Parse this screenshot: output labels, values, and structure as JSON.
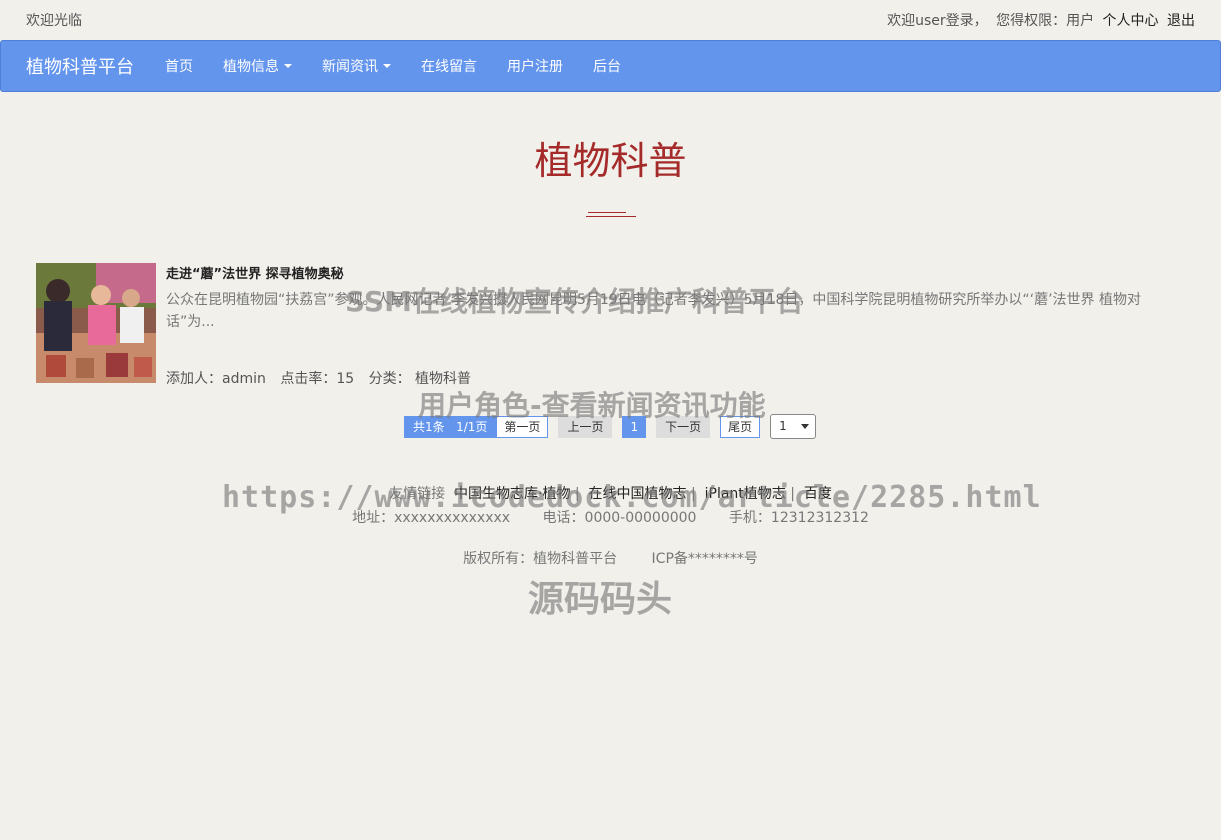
{
  "topbar": {
    "welcome": "欢迎光临",
    "login_text": "欢迎user登录，",
    "permission_text": "您得权限：用户",
    "personal_center": "个人中心",
    "logout": "退出"
  },
  "navbar": {
    "brand": "植物科普平台",
    "items": [
      {
        "label": "首页"
      },
      {
        "label": "植物信息"
      },
      {
        "label": "新闻资讯"
      },
      {
        "label": "在线留言"
      },
      {
        "label": "用户注册"
      },
      {
        "label": "后台"
      }
    ]
  },
  "page": {
    "title": "植物科普"
  },
  "news": [
    {
      "title": "走进“蘑”法世界 探寻植物奥秘",
      "summary": "公众在昆明植物园“扶荔宫”参观。人民网记者 李发兴摄人民网昆明5月19日电（记者李发兴）5月18日，中国科学院昆明植物研究所举办以“‘蘑’法世界 植物对话”为...",
      "meta_added_by": "添加人：admin",
      "meta_clicks": "点击率：15",
      "meta_category": "分类：  植物科普"
    }
  ],
  "pagination": {
    "total": "共1条",
    "pages": "1/1页",
    "first": "第一页",
    "prev": "上一页",
    "current": "1",
    "next": "下一页",
    "last": "尾页",
    "select_value": "1"
  },
  "footer": {
    "links_label": "友情链接",
    "links": [
      "中国生物志库·植物",
      "在线中国植物志",
      "iPlant植物志",
      "百度"
    ],
    "separator": "|",
    "address": "地址：xxxxxxxxxxxxxx",
    "phone": "电话：0000-00000000",
    "mobile": "手机：12312312312",
    "copyright": "版权所有：植物科普平台",
    "icp": "ICP备********号"
  },
  "watermarks": {
    "line1": "SSM在线植物宣传介绍推广科普平台",
    "line2": "用户角色-查看新闻资讯功能",
    "line3": "https://www.icodedock.com/article/2285.html",
    "line4": "源码码头"
  },
  "colors": {
    "navbar_bg": "#6495ed",
    "title": "#a52a2a",
    "page_bg": "#f2f0eb"
  }
}
